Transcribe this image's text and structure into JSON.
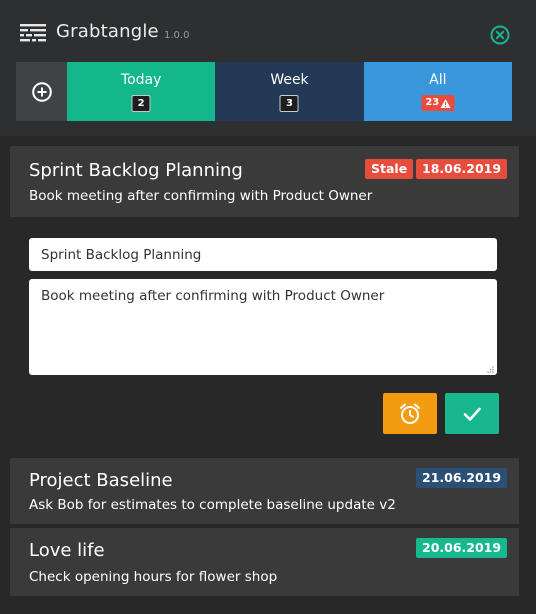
{
  "app": {
    "title": "Grabtangle",
    "version": "1.0.0"
  },
  "filters": {
    "tabs": [
      {
        "label": "Today",
        "count": "2"
      },
      {
        "label": "Week",
        "count": "3"
      },
      {
        "label": "All",
        "count": "23"
      }
    ]
  },
  "tasks": [
    {
      "title": "Sprint Backlog Planning",
      "description": "Book meeting after confirming with Product Owner",
      "stale_label": "Stale",
      "date": "18.06.2019",
      "edit": {
        "title_value": "Sprint Backlog Planning",
        "description_value": "Book meeting after confirming with Product Owner"
      }
    },
    {
      "title": "Project Baseline",
      "description": "Ask Bob for estimates to complete baseline update v2",
      "date": "21.06.2019"
    },
    {
      "title": "Love life",
      "description": "Check opening hours for flower shop",
      "date": "20.06.2019"
    }
  ],
  "icons": {
    "logo": "grabtangle-logo-icon",
    "close": "close-circle-icon",
    "add": "plus-circle-icon",
    "alert": "warning-triangle-icon",
    "alarm": "alarm-clock-icon",
    "done": "check-icon"
  },
  "colors": {
    "today": "#14b68b",
    "week": "#223a55",
    "all": "#3b97dc",
    "stale": "#e74c3c",
    "date_overdue": "#e74c3c",
    "date_future": "#2c4f75",
    "date_today": "#17b78f",
    "alarm": "#f39c12",
    "done": "#17b78f"
  }
}
